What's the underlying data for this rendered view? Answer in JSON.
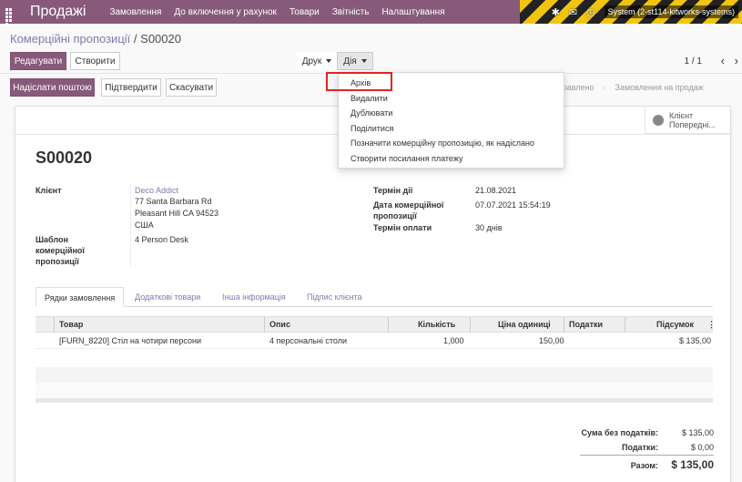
{
  "navbar": {
    "app_title": "Продажі",
    "menu": [
      "Замовлення",
      "До включення у рахунок",
      "Товари",
      "Звітність",
      "Налаштування"
    ],
    "user": "System (2-st114-kitworks-systems)"
  },
  "breadcrumb": {
    "parent": "Комерційні пропозиції",
    "separator": "/",
    "current": "S00020"
  },
  "toolbar": {
    "edit_label": "Редагувати",
    "create_label": "Створити",
    "print_label": "Друк",
    "action_label": "Дія",
    "pager": "1 / 1",
    "prev_icon": "‹",
    "next_icon": "›"
  },
  "statusbar_buttons": {
    "send_email": "Надіслати поштою",
    "confirm": "Підтвердити",
    "cancel": "Скасувати"
  },
  "status_steps": [
    "Комерційну пропозицію відправлено",
    "Замовлення на продаж"
  ],
  "smart_button": {
    "line1": "Клієнт",
    "line2": "Попередні..."
  },
  "document": {
    "name": "S00020",
    "customer_label": "Клієнт",
    "customer_name": "Deco Addict",
    "customer_addr1": "77 Santa Barbara Rd",
    "customer_addr2": "Pleasant Hill CA 94523",
    "customer_country": "США",
    "template_label": "Шаблон комерційної пропозиції",
    "template_value": "4 Person Desk",
    "expiration_label": "Термін дії",
    "expiration_value": "21.08.2021",
    "quotation_date_label": "Дата комерційної пропозиції",
    "quotation_date_value": "07.07.2021 15:54:19",
    "payment_terms_label": "Термін оплати",
    "payment_terms_value": "30 днів"
  },
  "tabs": [
    "Рядки замовлення",
    "Додаткові товари",
    "Інша інформація",
    "Підпис клієнта"
  ],
  "table": {
    "headers": [
      "Товар",
      "Опис",
      "Кількість",
      "Ціна одиниці",
      "Податки",
      "Підсумок"
    ],
    "rows": [
      [
        "[FURN_8220] Стіл на чотири персони",
        "4 персональні столи",
        "1,000",
        "150,00",
        "",
        "$ 135,00"
      ]
    ]
  },
  "totals": {
    "untaxed_label": "Сума без податків:",
    "untaxed_value": "$ 135,00",
    "taxes_label": "Податки:",
    "taxes_value": "$ 0,00",
    "total_label": "Разом:",
    "total_value": "$ 135,00"
  },
  "action_menu": {
    "items": [
      "Архів",
      "Видалити",
      "Дублювати",
      "Поділитися",
      "Позначити комерційну пропозицію, як надіслано",
      "Створити посилання платежу"
    ]
  },
  "colors": {
    "brand": "#875a7b",
    "link": "#7c7bad",
    "highlight": "#e02424"
  }
}
